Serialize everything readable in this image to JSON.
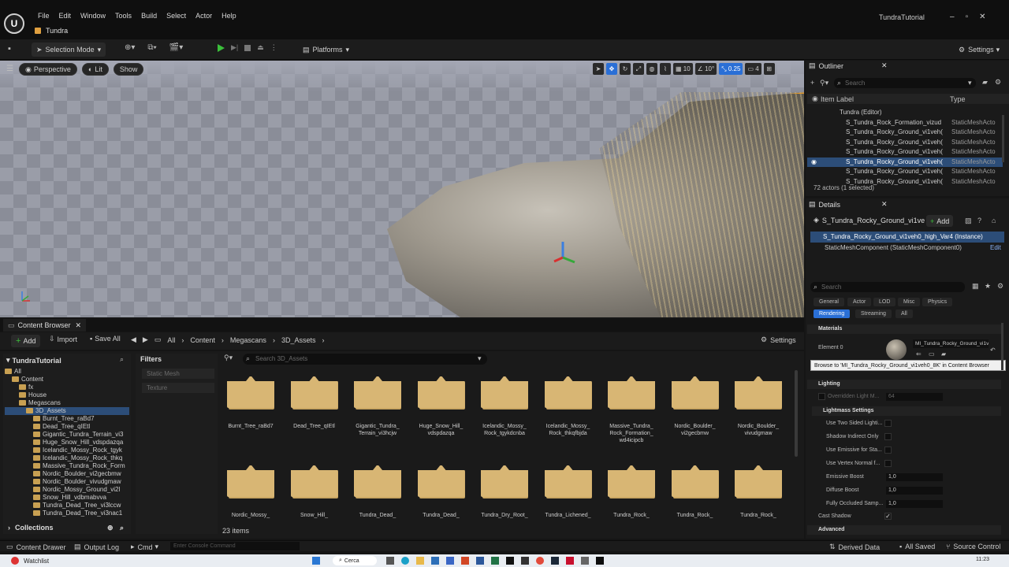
{
  "app": {
    "logo": "U",
    "window_title": "TundraTutorial",
    "project_tab": "Tundra",
    "menu": [
      "File",
      "Edit",
      "Window",
      "Tools",
      "Build",
      "Select",
      "Actor",
      "Help"
    ]
  },
  "toolbar": {
    "selection_mode": "Selection Mode",
    "platforms": "Platforms",
    "settings": "Settings"
  },
  "viewport": {
    "perspective": "Perspective",
    "lit": "Lit",
    "show": "Show",
    "grid_size": "10",
    "rotation_snap": "10°",
    "scale_snap": "0.25",
    "camera_speed": "4"
  },
  "content_browser": {
    "tab": "Content Browser",
    "add": "Add",
    "import": "Import",
    "save_all": "Save All",
    "breadcrumbs": [
      "All",
      "Content",
      "Megascans",
      "3D_Assets"
    ],
    "settings": "Settings",
    "tree_header": "TundraTutorial",
    "tree": [
      {
        "label": "All",
        "depth": 0
      },
      {
        "label": "Content",
        "depth": 1
      },
      {
        "label": "fx",
        "depth": 2
      },
      {
        "label": "House",
        "depth": 2
      },
      {
        "label": "Megascans",
        "depth": 2
      },
      {
        "label": "3D_Assets",
        "depth": 3,
        "selected": true
      },
      {
        "label": "Burnt_Tree_raBd7",
        "depth": 4
      },
      {
        "label": "Dead_Tree_qIEtl",
        "depth": 4
      },
      {
        "label": "Gigantic_Tundra_Terrain_vi3",
        "depth": 4
      },
      {
        "label": "Huge_Snow_Hill_vdspdazqa",
        "depth": 4
      },
      {
        "label": "Icelandic_Mossy_Rock_tgyk",
        "depth": 4
      },
      {
        "label": "Icelandic_Mossy_Rock_thkq",
        "depth": 4
      },
      {
        "label": "Massive_Tundra_Rock_Form",
        "depth": 4
      },
      {
        "label": "Nordic_Boulder_vi2gecbmw",
        "depth": 4
      },
      {
        "label": "Nordic_Boulder_vivudgmaw",
        "depth": 4
      },
      {
        "label": "Nordic_Mossy_Ground_vi2l",
        "depth": 4
      },
      {
        "label": "Snow_Hill_vdbmabvva",
        "depth": 4
      },
      {
        "label": "Tundra_Dead_Tree_vi3lccw",
        "depth": 4
      },
      {
        "label": "Tundra_Dead_Tree_vi3nac1",
        "depth": 4
      }
    ],
    "collections": "Collections",
    "filters_title": "Filters",
    "filter_tags": [
      "Static Mesh",
      "Texture"
    ],
    "search_placeholder": "Search 3D_Assets",
    "folders_row1": [
      "Burnt_Tree_raBd7",
      "Dead_Tree_qIEtl",
      "Gigantic_Tundra_\nTerrain_vi3hcjw",
      "Huge_Snow_Hill_\nvdspdazqa",
      "Icelandic_Mossy_\nRock_tgykdcnba",
      "Icelandic_Mossy_\nRock_thkqfbjda",
      "Massive_Tundra_\nRock_Formation_\nwd4icipcb",
      "Nordic_Boulder_\nvi2gecbmw",
      "Nordic_Boulder_\nvivudgmaw"
    ],
    "folders_row2": [
      "Nordic_Mossy_",
      "Snow_Hill_",
      "Tundra_Dead_",
      "Tundra_Dead_",
      "Tundra_Dry_Root_",
      "Tundra_Lichened_",
      "Tundra_Rock_",
      "Tundra_Rock_",
      "Tundra_Rock_"
    ],
    "item_count": "23 items"
  },
  "outliner": {
    "tab": "Outliner",
    "search_placeholder": "Search",
    "col_label": "Item Label",
    "col_type": "Type",
    "rows": [
      {
        "name": "Tundra (Editor)",
        "type": "",
        "indent": 0
      },
      {
        "name": "S_Tundra_Rock_Formation_vizud",
        "type": "StaticMeshActo",
        "indent": 1
      },
      {
        "name": "S_Tundra_Rocky_Ground_vi1veh(",
        "type": "StaticMeshActo",
        "indent": 1
      },
      {
        "name": "S_Tundra_Rocky_Ground_vi1veh(",
        "type": "StaticMeshActo",
        "indent": 1
      },
      {
        "name": "S_Tundra_Rocky_Ground_vi1veh(",
        "type": "StaticMeshActo",
        "indent": 1
      },
      {
        "name": "S_Tundra_Rocky_Ground_vi1veh(",
        "type": "StaticMeshActo",
        "indent": 1,
        "selected": true
      },
      {
        "name": "S_Tundra_Rocky_Ground_vi1veh(",
        "type": "StaticMeshActo",
        "indent": 1
      },
      {
        "name": "S_Tundra_Rocky_Ground_vi1veh(",
        "type": "StaticMeshActo",
        "indent": 1
      }
    ],
    "count": "72 actors (1 selected)"
  },
  "details": {
    "tab": "Details",
    "actor_name": "S_Tundra_Rocky_Ground_vi1ve",
    "add": "Add",
    "instance": "S_Tundra_Rocky_Ground_vi1veh0_high_Var4 (Instance)",
    "component": "StaticMeshComponent (StaticMeshComponent0)",
    "edit": "Edit",
    "search_placeholder": "Search",
    "cats1": [
      "General",
      "Actor",
      "LOD",
      "Misc",
      "Physics"
    ],
    "cats2": [
      "Rendering",
      "Streaming",
      "All"
    ],
    "materials_section": "Materials",
    "element0": "Element 0",
    "material_name": "MI_Tundra_Rocky_Ground_vi1v",
    "tooltip": "Browse to 'MI_Tundra_Rocky_Ground_vi1veh0_8K' in Content Browser",
    "lighting_section": "Lighting",
    "overridden_lightmap": "Overridden Light M...",
    "overridden_value": "64",
    "lightmass_section": "Lightmass Settings",
    "lightmass_props": [
      {
        "label": "Use Two Sided Lighti...",
        "type": "check",
        "value": ""
      },
      {
        "label": "Shadow Indirect Only",
        "type": "check",
        "value": ""
      },
      {
        "label": "Use Emissive for Sta...",
        "type": "check",
        "value": ""
      },
      {
        "label": "Use Vertex Normal f...",
        "type": "check",
        "value": ""
      },
      {
        "label": "Emissive Boost",
        "type": "num",
        "value": "1,0"
      },
      {
        "label": "Diffuse Boost",
        "type": "num",
        "value": "1,0"
      },
      {
        "label": "Fully Occluded Samp...",
        "type": "num",
        "value": "1,0"
      }
    ],
    "cast_shadow": "Cast Shadow",
    "advanced": "Advanced"
  },
  "statusbar": {
    "content_drawer": "Content Drawer",
    "output_log": "Output Log",
    "cmd": "Cmd",
    "console_placeholder": "Enter Console Command",
    "derived_data": "Derived Data",
    "all_saved": "All Saved",
    "source_control": "Source Control"
  },
  "taskbar": {
    "watchlist": "Watchlist",
    "search": "Cerca",
    "time": "11:23"
  }
}
